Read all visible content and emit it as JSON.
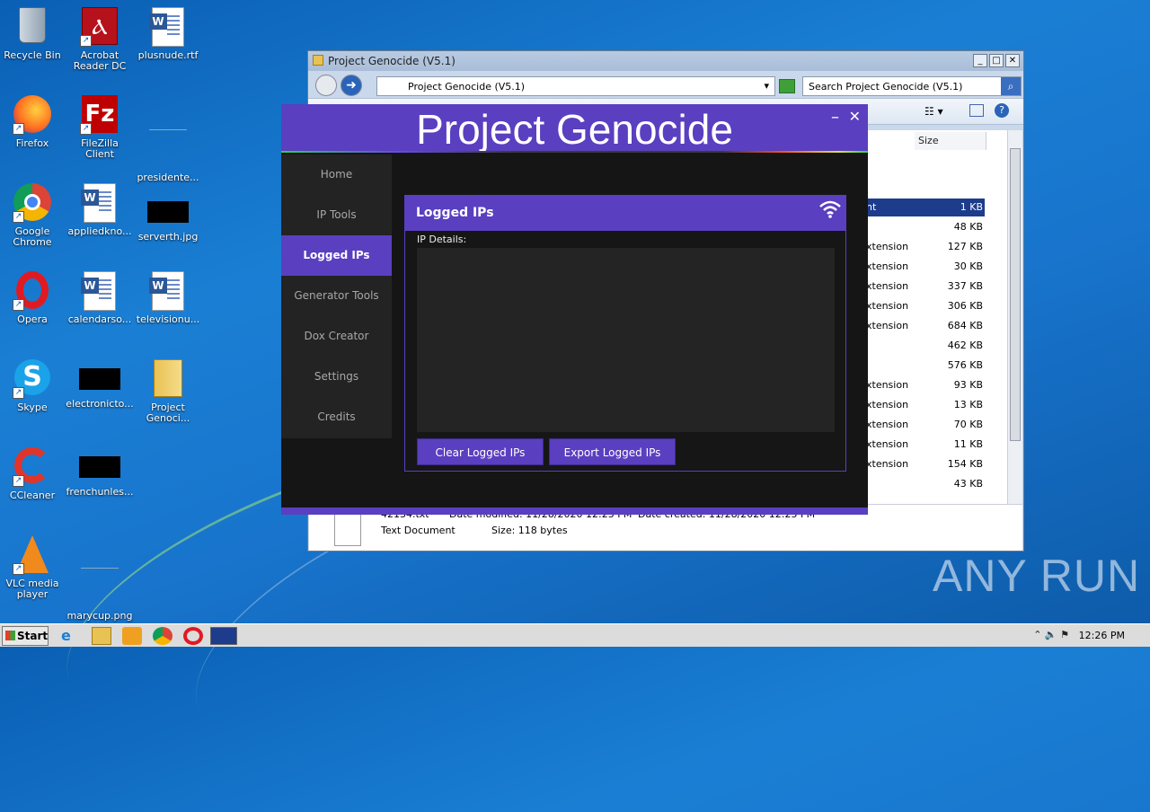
{
  "desktop": {
    "icons": [
      {
        "label": "Recycle Bin"
      },
      {
        "label": "Acrobat Reader DC"
      },
      {
        "label": "plusnude.rtf"
      },
      {
        "label": "Firefox"
      },
      {
        "label": "FileZilla Client"
      },
      {
        "label": "presidente..."
      },
      {
        "label": "Google Chrome"
      },
      {
        "label": "appliedkno..."
      },
      {
        "label": "serverth.jpg"
      },
      {
        "label": "Opera"
      },
      {
        "label": "calendarso..."
      },
      {
        "label": "televisionu..."
      },
      {
        "label": "Skype"
      },
      {
        "label": "electronicto..."
      },
      {
        "label": "Project Genoci..."
      },
      {
        "label": "CCleaner"
      },
      {
        "label": "frenchunles..."
      },
      {
        "label": "VLC media player"
      },
      {
        "label": "marycup.png"
      }
    ]
  },
  "explorer": {
    "title": "Project Genocide (V5.1)",
    "address": "Project Genocide (V5.1)",
    "search_placeholder": "Search Project Genocide (V5.1)",
    "size_header": "Size",
    "rows": [
      {
        "type": "nt",
        "size": "1 KB"
      },
      {
        "type": "",
        "size": "48 KB"
      },
      {
        "type": "xtension",
        "size": "127 KB"
      },
      {
        "type": "xtension",
        "size": "30 KB"
      },
      {
        "type": "xtension",
        "size": "337 KB"
      },
      {
        "type": "xtension",
        "size": "306 KB"
      },
      {
        "type": "xtension",
        "size": "684 KB"
      },
      {
        "type": "",
        "size": "462 KB"
      },
      {
        "type": "",
        "size": "576 KB"
      },
      {
        "type": "xtension",
        "size": "93 KB"
      },
      {
        "type": "xtension",
        "size": "13 KB"
      },
      {
        "type": "xtension",
        "size": "70 KB"
      },
      {
        "type": "xtension",
        "size": "11 KB"
      },
      {
        "type": "xtension",
        "size": "154 KB"
      },
      {
        "type": "",
        "size": "43 KB"
      }
    ],
    "details": {
      "filename": "42134.txt",
      "modified": "Date modified: 11/28/2020 12:25 PM",
      "created": "Date created: 11/28/2020 12:25 PM",
      "type": "Text Document",
      "size": "Size: 118 bytes"
    }
  },
  "app": {
    "title": "Project Genocide",
    "minimize": "–",
    "close": "✕",
    "nav": [
      "Home",
      "IP Tools",
      "Logged IPs",
      "Generator Tools",
      "Dox Creator",
      "Settings",
      "Credits"
    ],
    "active_nav": "Logged IPs",
    "panel_title": "Logged IPs",
    "details_label": "IP Details:",
    "clear_button": "Clear Logged IPs",
    "export_button": "Export Logged IPs",
    "accent": "#5a3fc0"
  },
  "taskbar": {
    "start_label": "Start",
    "clock": "12:26 PM"
  },
  "watermark": "ANY RUN"
}
